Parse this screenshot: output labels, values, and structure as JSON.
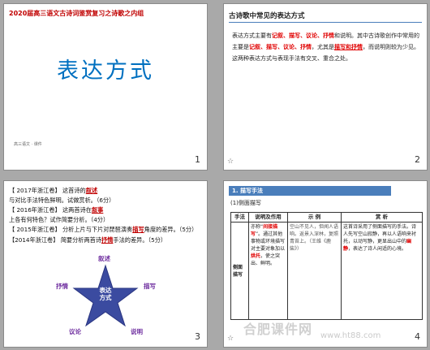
{
  "slides": {
    "s1": {
      "title": "2020届高三语文古诗词鉴赏复习之诗歌之内组",
      "main": "表达方式",
      "footer": "高三语文 · 课件",
      "number": "1"
    },
    "s2": {
      "heading": "古诗歌中常见的表达方式",
      "body_1": "表达方式主要有",
      "kw1": "记叙",
      "sep1": "、",
      "kw2": "描写",
      "sep2": "、",
      "kw3": "议论",
      "sep3": "、",
      "kw4": "抒情",
      "body_2": "和说明。其中古诗歌创作中常用的主要是",
      "kw5": "记叙",
      "sep4": "、",
      "kw6": "描写",
      "sep5": "、",
      "kw7": "议论",
      "sep6": "、",
      "kw8": "抒情",
      "body_3": "，尤其是",
      "kw9": "描写和抒情",
      "body_4": "，而说明则较为少见。这两种表达方式与表现手法有交叉、重合之处。",
      "mark": "☆",
      "number": "2"
    },
    "s3": {
      "q1_a": "【 2017年浙江卷】 这首诗的",
      "q1_k": "叙述",
      "q1_b": "与对比手法特色鲜明。试做赏析。（6分）",
      "q2_a": "【 2016年浙江卷】 这两首诗在",
      "q2_k": "叙事",
      "q2_b": "上各有何特色？试作简要分析。（4分）",
      "q3_a": "【 2015年浙江卷】 分析上片与下片对琵琶演奏",
      "q3_k": "描写",
      "q3_b": "角度的差异。（5分）",
      "q4_a": "【2014年浙江卷】 简要分析两首诗",
      "q4_k": "抒情",
      "q4_b": "手法的差异。（5分）",
      "star": {
        "top": "叙述",
        "left": "抒情",
        "right": "描写",
        "bottom_left": "议论",
        "bottom_right": "说明",
        "center_1": "表达",
        "center_2": "方式"
      },
      "number": "3"
    },
    "s4": {
      "bar": "1. 描写手法",
      "sub": "(1)侧面描写",
      "table": {
        "headers": [
          "手法",
          "说明及作用",
          "示  例",
          "赏  析"
        ],
        "row_method": "侧面描写",
        "col2_a": "亦称“",
        "col2_k1": "间接描写",
        "col2_b": "”。通过其他事物或环境描写对主要对象加以",
        "col2_k2": "烘托",
        "col2_c": "，使之突出、鲜明。",
        "col3": "空山不见人，但闻人语响。返景入深林，复照青苔上。（王维《鹿柴》）",
        "col4_a": "这首诗采用了侧面描写的手法。诗人先写空山寂静，再以人语响来衬托，以动写静，更显出山中的",
        "col4_k": "幽静",
        "col4_b": "，表达了诗人闲适的心境。"
      },
      "mark": "☆",
      "number": "4"
    }
  },
  "watermark": "合肥课件网",
  "watermark_url": "www.ht88.com"
}
